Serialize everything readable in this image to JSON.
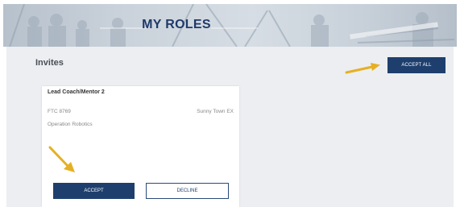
{
  "banner": {
    "title": "MY ROLES"
  },
  "invites": {
    "section_title": "Invites",
    "accept_all_label": "ACCEPT ALL"
  },
  "invite_card": {
    "role": "Lead Coach/Mentor 2",
    "team_number": "FTC 8769",
    "location": "Sunny Town EX",
    "team_name": "Operation Robotics",
    "accept_label": "ACCEPT",
    "decline_label": "DECLINE"
  },
  "colors": {
    "primary_navy": "#1e3f6e",
    "content_background": "#eceef1",
    "annotation_arrow": "#e6b023"
  },
  "icons": {
    "annotation_right": "arrow-right-icon",
    "annotation_down": "arrow-down-right-icon"
  }
}
